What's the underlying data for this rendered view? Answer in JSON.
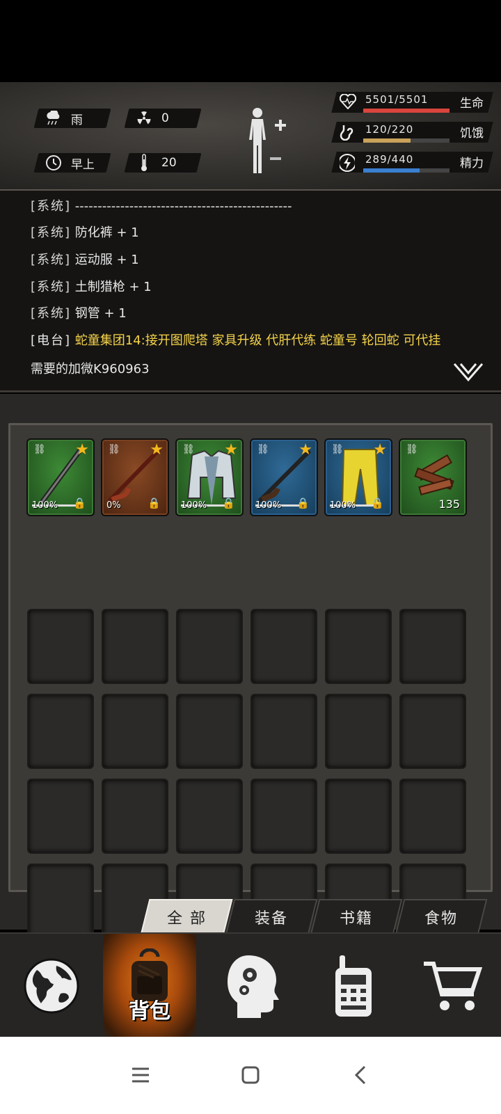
{
  "status": {
    "weather": {
      "icon": "rain-icon",
      "label": "雨"
    },
    "radiation": {
      "icon": "radiation-icon",
      "value": "0"
    },
    "time": {
      "icon": "clock-icon",
      "label": "早上"
    },
    "temperature": {
      "icon": "thermometer-icon",
      "value": "20"
    },
    "health": {
      "value": "5501/5501",
      "label": "生命",
      "fraction": 1.0,
      "color": "#d9453d"
    },
    "hunger": {
      "value": "120/220",
      "label": "饥饿",
      "fraction": 0.545,
      "color": "#c9a25a"
    },
    "energy": {
      "value": "289/440",
      "label": "精力",
      "fraction": 0.657,
      "color": "#3a7fd0"
    }
  },
  "log": [
    {
      "tag": "[系统]",
      "msg": "------------------------------------------------"
    },
    {
      "tag": "[系统]",
      "msg": "防化裤 + 1"
    },
    {
      "tag": "[系统]",
      "msg": "运动服 + 1"
    },
    {
      "tag": "[系统]",
      "msg": "土制猎枪 + 1"
    },
    {
      "tag": "[系统]",
      "msg": "钢管 + 1"
    },
    {
      "tag": "[电台]",
      "msg": "蛇童集团14:接开图爬塔 家具升级 代肝代练 蛇童号 轮回蛇 可代挂"
    }
  ],
  "log_continuation": "需要的加微K960963",
  "inventory": {
    "items": [
      {
        "name": "steel-pipe",
        "rarity": "green",
        "durability": "100%",
        "durability_fraction": 1.0
      },
      {
        "name": "homemade-shotgun-red",
        "rarity": "brown",
        "durability": "0%",
        "durability_fraction": 0.0
      },
      {
        "name": "sports-jacket",
        "rarity": "green",
        "durability": "100%",
        "durability_fraction": 1.0
      },
      {
        "name": "homemade-shotgun",
        "rarity": "blue",
        "durability": "100%",
        "durability_fraction": 1.0
      },
      {
        "name": "hazmat-pants",
        "rarity": "blue",
        "durability": "100%",
        "durability_fraction": 1.0
      },
      {
        "name": "wood",
        "rarity": "green",
        "count": "135"
      }
    ]
  },
  "tabs": [
    "全 部",
    "装备",
    "书籍",
    "食物"
  ],
  "nav": {
    "world": "globe-icon",
    "backpack_label": "背包",
    "skills": "head-gears-icon",
    "radio": "walkie-talkie-icon",
    "shop": "cart-icon"
  },
  "system_nav": [
    "menu-icon",
    "home-icon",
    "back-icon"
  ]
}
